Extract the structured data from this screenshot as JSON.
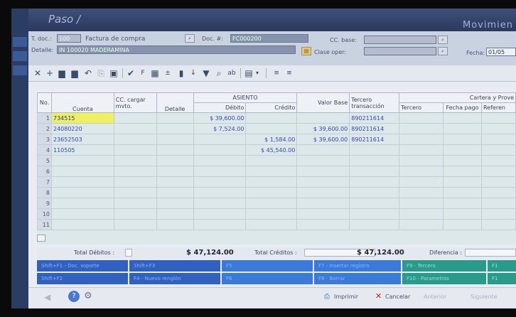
{
  "window": {
    "title": "Paso /",
    "module": "Movimien"
  },
  "header": {
    "tdoc_label": "T. doc.:",
    "tdoc_value": "100",
    "tdoc_name": "Factura de compra",
    "doc_label": "Doc. #:",
    "doc_value": "FC000200",
    "cc_base_label": "CC. base:",
    "cc_base_value": "",
    "detalle_label": "Detalle:",
    "detalle_value": "IN 100020 MADERAMINA",
    "clase_label": "Clase oper:",
    "clase_value": "",
    "fecha_label": "Fecha:",
    "fecha_value": "01/05"
  },
  "toolbar": {
    "icons": [
      "close-icon",
      "add-icon",
      "insert-row-icon",
      "delete-row-icon",
      "undo-icon",
      "copy-icon",
      "paste-icon",
      "check-icon",
      "flag-icon",
      "grid-icon",
      "sum-icon",
      "document-icon",
      "sort-icon",
      "filter-icon",
      "search-icon",
      "format-icon",
      "export-icon",
      "dropdown-icon",
      "align-left-icon",
      "align-right-icon"
    ]
  },
  "grid": {
    "group_headers": {
      "asiento": "ASIENTO",
      "cartera": "Cartera y Prove"
    },
    "headers": {
      "no": "No.",
      "cuenta": "Cuenta",
      "cc": "CC. cargar mvto.",
      "detalle": "Detalle",
      "debito": "Débito",
      "credito": "Crédito",
      "valor_base": "Valor Base",
      "tercero_trans": "Tercero transacción",
      "tercero": "Tercero",
      "fecha_pago": "Fecha pago",
      "referencia": "Referen"
    },
    "rows": [
      {
        "no": "1",
        "cuenta": "734515",
        "cc": "",
        "detalle": "",
        "debito": "$ 39,600.00",
        "credito": "",
        "base": "",
        "tercero_trans": "890211614"
      },
      {
        "no": "2",
        "cuenta": "24080220",
        "cc": "",
        "detalle": "",
        "debito": "$ 7,524.00",
        "credito": "",
        "base": "$ 39,600.00",
        "tercero_trans": "890211614"
      },
      {
        "no": "3",
        "cuenta": "23652503",
        "cc": "",
        "detalle": "",
        "debito": "",
        "credito": "$ 1,584.00",
        "base": "$ 39,600.00",
        "tercero_trans": "890211614"
      },
      {
        "no": "4",
        "cuenta": "110505",
        "cc": "",
        "detalle": "",
        "debito": "",
        "credito": "$ 45,540.00",
        "base": "",
        "tercero_trans": ""
      },
      {
        "no": "5"
      },
      {
        "no": "6"
      },
      {
        "no": "7"
      },
      {
        "no": "8"
      },
      {
        "no": "9"
      },
      {
        "no": "10"
      },
      {
        "no": "11"
      }
    ]
  },
  "totals": {
    "debitos_label": "Total Débitos :",
    "debitos_value": "$ 47,124.00",
    "creditos_label": "Total Créditos :",
    "creditos_value": "$ 47,124.00",
    "diferencia_label": "Diferencia :"
  },
  "keys": {
    "row1": [
      "Shift+F1 - Doc. soporte",
      "Shift+F3",
      "F5",
      "F7 - Insertar registro",
      "F9 - Tercero",
      "F1"
    ],
    "row2": [
      "Shift+F2",
      "F4 - Nuevo renglón",
      "F6",
      "F8 - Borrar",
      "F10 - Parametros",
      "F1"
    ]
  },
  "bottom": {
    "imprimir": "Imprimir",
    "cancelar": "Cancelar",
    "anterior": "Anterior",
    "siguiente": "Siguiente"
  },
  "colors": {
    "selected_cell": "#eef060",
    "value_text": "#3a46b4",
    "titlebar": "#2c3960"
  }
}
